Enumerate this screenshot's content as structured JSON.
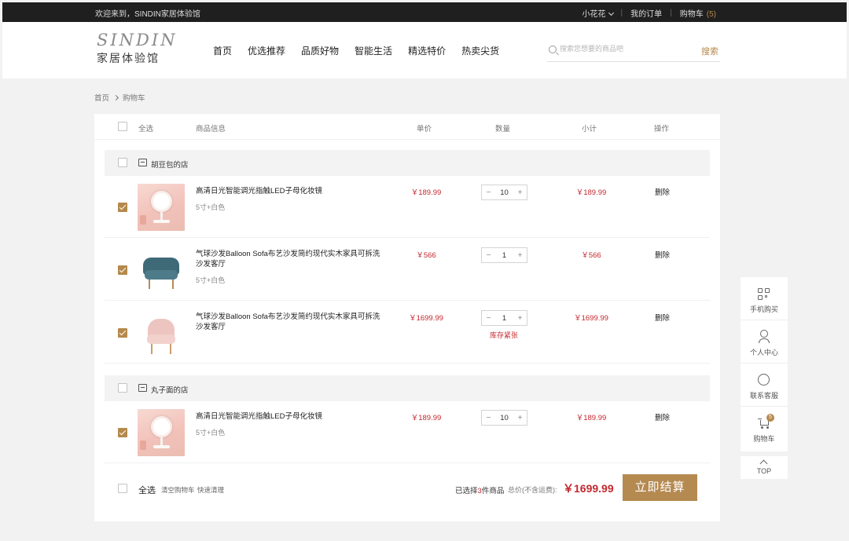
{
  "topbar": {
    "welcome": "欢迎来到，SINDIN家居体验馆",
    "user": "小花花",
    "orders": "我的订单",
    "cart": "购物车",
    "cart_count": "(5)"
  },
  "logo": {
    "en": "SINDIN",
    "cn": "家居体验馆"
  },
  "nav": [
    "首页",
    "优选推荐",
    "品质好物",
    "智能生活",
    "精选特价",
    "热卖尖货"
  ],
  "search": {
    "placeholder": "搜索您想要的商品吧",
    "button": "搜索"
  },
  "breadcrumb": [
    "首页",
    "购物车"
  ],
  "table_headers": {
    "select_all": "全选",
    "info": "商品信息",
    "unit_price": "单价",
    "quantity": "数量",
    "subtotal": "小计",
    "action": "操作"
  },
  "shops": [
    {
      "name": "胡豆包的店",
      "checked": false,
      "items": [
        {
          "title": "高清日光智能调光指触LED子母化妆镜",
          "spec": "5寸+白色",
          "price": "￥189.99",
          "qty": "10",
          "subtotal": "￥189.99",
          "action": "删除",
          "checked": true,
          "image": "mirror"
        },
        {
          "title": "气球沙发Balloon Sofa布艺沙发简约现代实木家具可拆洗沙发客厅",
          "spec": "5寸+白色",
          "price": "￥566",
          "qty": "1",
          "subtotal": "￥566",
          "action": "删除",
          "checked": true,
          "image": "blue-armchair"
        },
        {
          "title": "气球沙发Balloon Sofa布艺沙发简约现代实木家具可拆洗沙发客厅",
          "spec": "",
          "price": "￥1699.99",
          "qty": "1",
          "subtotal": "￥1699.99",
          "action": "删除",
          "checked": true,
          "image": "pink-armchair",
          "stock_warning": "库存紧张"
        }
      ]
    },
    {
      "name": "丸子面的店",
      "checked": false,
      "items": [
        {
          "title": "高清日光智能调光指触LED子母化妆镜",
          "spec": "5寸+白色",
          "price": "￥189.99",
          "qty": "10",
          "subtotal": "￥189.99",
          "action": "删除",
          "checked": true,
          "image": "mirror"
        }
      ]
    }
  ],
  "footer": {
    "select_all": "全选",
    "clear": "清空购物车",
    "quick_clean": "快速清理",
    "selected_prefix": "已选择",
    "selected_count": "3",
    "selected_suffix": "件商品",
    "total_label": "总价(不含运费):",
    "total": "￥1699.99",
    "checkout": "立即结算"
  },
  "sidebar": {
    "mobile": "手机购买",
    "profile": "个人中心",
    "service": "联系客服",
    "cart": "购物车",
    "cart_badge": "5",
    "top": "TOP"
  },
  "colors": {
    "accent": "#b5894b",
    "price": "#c4282f",
    "topbar": "#1f1f1f"
  }
}
